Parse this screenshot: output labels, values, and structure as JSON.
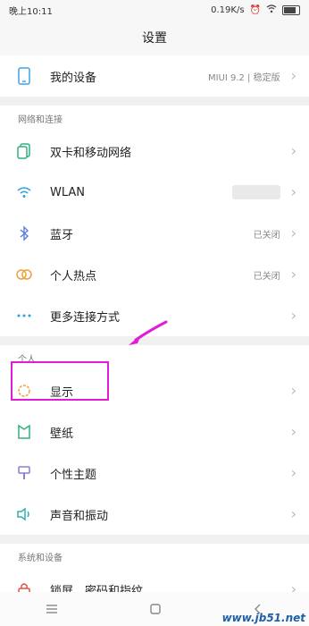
{
  "status": {
    "time": "晚上10:11",
    "speed": "0.19K/s"
  },
  "title": "设置",
  "my_device": {
    "label": "我的设备",
    "value": "MIUI 9.2 | 稳定版"
  },
  "sections": {
    "network": "网络和连接",
    "personal": "个人",
    "system": "系统和设备"
  },
  "network_items": [
    {
      "label": "双卡和移动网络",
      "value": ""
    },
    {
      "label": "WLAN",
      "value": ""
    },
    {
      "label": "蓝牙",
      "value": "已关闭"
    },
    {
      "label": "个人热点",
      "value": "已关闭"
    },
    {
      "label": "更多连接方式",
      "value": ""
    }
  ],
  "personal_items": [
    {
      "label": "显示"
    },
    {
      "label": "壁纸"
    },
    {
      "label": "个性主题"
    },
    {
      "label": "声音和振动"
    }
  ],
  "system_items": [
    {
      "label": "锁屏、密码和指纹"
    }
  ],
  "watermark": "www.jb51.net",
  "colors": {
    "highlight": "#e21bd9",
    "arrow": "#e21bd9"
  }
}
